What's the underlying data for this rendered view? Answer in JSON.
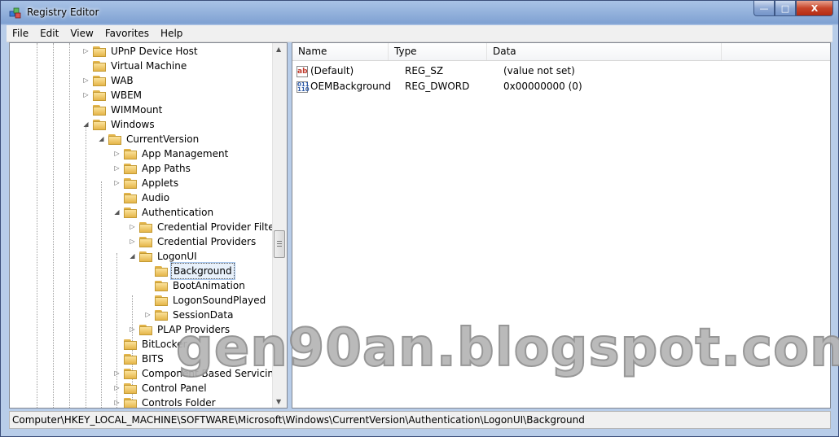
{
  "window": {
    "title": "Registry Editor",
    "minimize": "—",
    "maximize": "□",
    "close": "X"
  },
  "menu": [
    "File",
    "Edit",
    "View",
    "Favorites",
    "Help"
  ],
  "tree": [
    {
      "label": "UPnP Device Host",
      "depth": 0,
      "expander": "collapsed"
    },
    {
      "label": "Virtual Machine",
      "depth": 0,
      "expander": "none"
    },
    {
      "label": "WAB",
      "depth": 0,
      "expander": "collapsed"
    },
    {
      "label": "WBEM",
      "depth": 0,
      "expander": "collapsed"
    },
    {
      "label": "WIMMount",
      "depth": 0,
      "expander": "none"
    },
    {
      "label": "Windows",
      "depth": 0,
      "expander": "expanded"
    },
    {
      "label": "CurrentVersion",
      "depth": 1,
      "expander": "expanded"
    },
    {
      "label": "App Management",
      "depth": 2,
      "expander": "collapsed"
    },
    {
      "label": "App Paths",
      "depth": 2,
      "expander": "collapsed"
    },
    {
      "label": "Applets",
      "depth": 2,
      "expander": "collapsed"
    },
    {
      "label": "Audio",
      "depth": 2,
      "expander": "none"
    },
    {
      "label": "Authentication",
      "depth": 2,
      "expander": "expanded"
    },
    {
      "label": "Credential Provider Filters",
      "depth": 3,
      "expander": "collapsed"
    },
    {
      "label": "Credential Providers",
      "depth": 3,
      "expander": "collapsed"
    },
    {
      "label": "LogonUI",
      "depth": 3,
      "expander": "expanded"
    },
    {
      "label": "Background",
      "depth": 4,
      "expander": "none",
      "selected": true
    },
    {
      "label": "BootAnimation",
      "depth": 4,
      "expander": "none"
    },
    {
      "label": "LogonSoundPlayed",
      "depth": 4,
      "expander": "none"
    },
    {
      "label": "SessionData",
      "depth": 4,
      "expander": "collapsed"
    },
    {
      "label": "PLAP Providers",
      "depth": 3,
      "expander": "collapsed"
    },
    {
      "label": "BitLocker",
      "depth": 2,
      "expander": "none"
    },
    {
      "label": "BITS",
      "depth": 2,
      "expander": "none"
    },
    {
      "label": "Component Based Servicing",
      "depth": 2,
      "expander": "collapsed"
    },
    {
      "label": "Control Panel",
      "depth": 2,
      "expander": "collapsed"
    },
    {
      "label": "Controls Folder",
      "depth": 2,
      "expander": "collapsed"
    }
  ],
  "list": {
    "columns": [
      "Name",
      "Type",
      "Data"
    ],
    "rows": [
      {
        "icon": "string-value-icon",
        "badge": "ab",
        "name": "(Default)",
        "type": "REG_SZ",
        "data": "(value not set)"
      },
      {
        "icon": "binary-value-icon",
        "badge": "011 110",
        "name": "OEMBackground",
        "type": "REG_DWORD",
        "data": "0x00000000 (0)"
      }
    ]
  },
  "statusbar": {
    "path": "Computer\\HKEY_LOCAL_MACHINE\\SOFTWARE\\Microsoft\\Windows\\CurrentVersion\\Authentication\\LogonUI\\Background"
  },
  "watermark": "gen90an.blogspot.com",
  "colors": {
    "folder": "#e5b64a",
    "selection": "#e8f1fb",
    "titlebar": "#7fa1d2"
  }
}
